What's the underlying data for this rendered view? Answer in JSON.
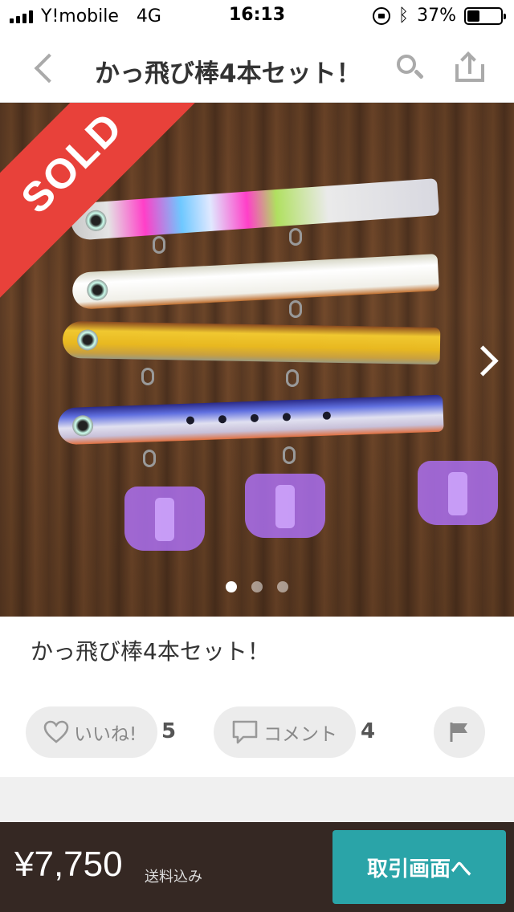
{
  "status_bar": {
    "carrier": "Y!mobile",
    "network": "4G",
    "time": "16:13",
    "battery_percent": "37%",
    "battery_level": 0.37
  },
  "nav": {
    "title": "かっ飛び棒4本セット！",
    "icons": [
      "chevron-left-icon",
      "search-icon",
      "share-icon"
    ]
  },
  "photo": {
    "sold_label": "SOLD",
    "pager_count": 3,
    "pager_active_index": 0
  },
  "item": {
    "name": "かっ飛び棒4本セット！"
  },
  "actions": {
    "like_label": "いいね!",
    "like_count": "5",
    "comment_label": "コメント",
    "comment_count": "4"
  },
  "bottom_bar": {
    "price": "¥7,750",
    "shipping_note": "送料込み",
    "trade_button_label": "取引画面へ"
  },
  "colors": {
    "sold_ribbon": "#e8413a",
    "bottom_bar": "#352823",
    "trade_button": "#2aa4a8"
  }
}
